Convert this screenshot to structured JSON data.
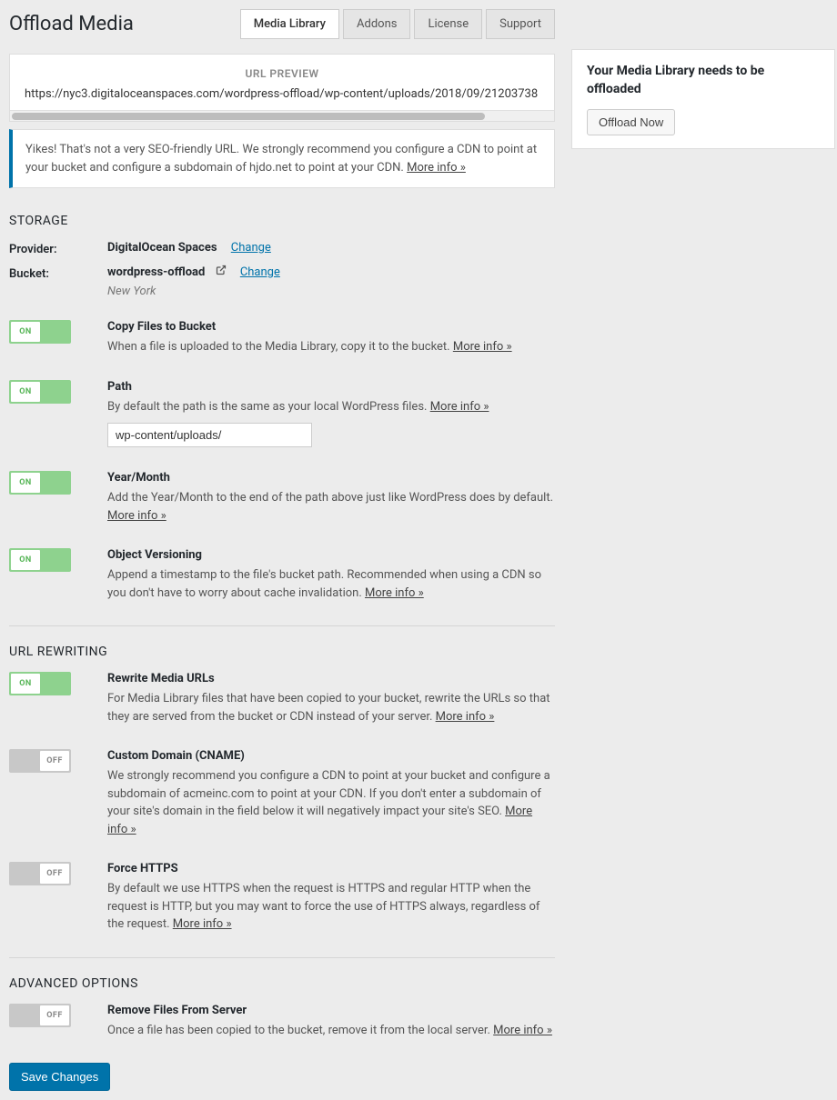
{
  "header": {
    "title": "Offload Media",
    "tabs": [
      "Media Library",
      "Addons",
      "License",
      "Support"
    ],
    "active_tab": 0
  },
  "url_preview": {
    "label": "URL PREVIEW",
    "url": "https://nyc3.digitaloceanspaces.com/wordpress-offload/wp-content/uploads/2018/09/21203738"
  },
  "seo_notice": {
    "text": "Yikes! That's not a very SEO-friendly URL. We strongly recommend you configure a CDN to point at your bucket and configure a subdomain of hjdo.net to point at your CDN. ",
    "more_info": "More info »"
  },
  "storage": {
    "heading": "STORAGE",
    "provider_label": "Provider:",
    "provider_value": "DigitalOcean Spaces",
    "provider_change": "Change",
    "bucket_label": "Bucket:",
    "bucket_value": "wordpress-offload",
    "bucket_change": "Change",
    "region": "New York"
  },
  "settings": {
    "copy": {
      "on": true,
      "title": "Copy Files to Bucket",
      "desc": "When a file is uploaded to the Media Library, copy it to the bucket. ",
      "more_info": "More info »"
    },
    "path": {
      "on": true,
      "title": "Path",
      "desc": "By default the path is the same as your local WordPress files. ",
      "more_info": "More info »",
      "value": "wp-content/uploads/"
    },
    "yearmonth": {
      "on": true,
      "title": "Year/Month",
      "desc": "Add the Year/Month to the end of the path above just like WordPress does by default. ",
      "more_info": "More info »"
    },
    "versioning": {
      "on": true,
      "title": "Object Versioning",
      "desc": "Append a timestamp to the file's bucket path. Recommended when using a CDN so you don't have to worry about cache invalidation. ",
      "more_info": "More info »"
    }
  },
  "rewriting": {
    "heading": "URL REWRITING",
    "rewrite": {
      "on": true,
      "title": "Rewrite Media URLs",
      "desc": "For Media Library files that have been copied to your bucket, rewrite the URLs so that they are served from the bucket or CDN instead of your server. ",
      "more_info": "More info »"
    },
    "cname": {
      "on": false,
      "title": "Custom Domain (CNAME)",
      "desc": "We strongly recommend you configure a CDN to point at your bucket and configure a subdomain of acmeinc.com to point at your CDN. If you don't enter a subdomain of your site's domain in the field below it will negatively impact your site's SEO. ",
      "more_info": "More info »"
    },
    "https": {
      "on": false,
      "title": "Force HTTPS",
      "desc": "By default we use HTTPS when the request is HTTPS and regular HTTP when the request is HTTP, but you may want to force the use of HTTPS always, regardless of the request. ",
      "more_info": "More info »"
    }
  },
  "advanced": {
    "heading": "ADVANCED OPTIONS",
    "remove": {
      "on": false,
      "title": "Remove Files From Server",
      "desc": "Once a file has been copied to the bucket, remove it from the local server. ",
      "more_info": "More info »"
    }
  },
  "save_button": "Save Changes",
  "sidebar": {
    "title": "Your Media Library needs to be offloaded",
    "button": "Offload Now"
  },
  "toggle_labels": {
    "on": "ON",
    "off": "OFF"
  }
}
